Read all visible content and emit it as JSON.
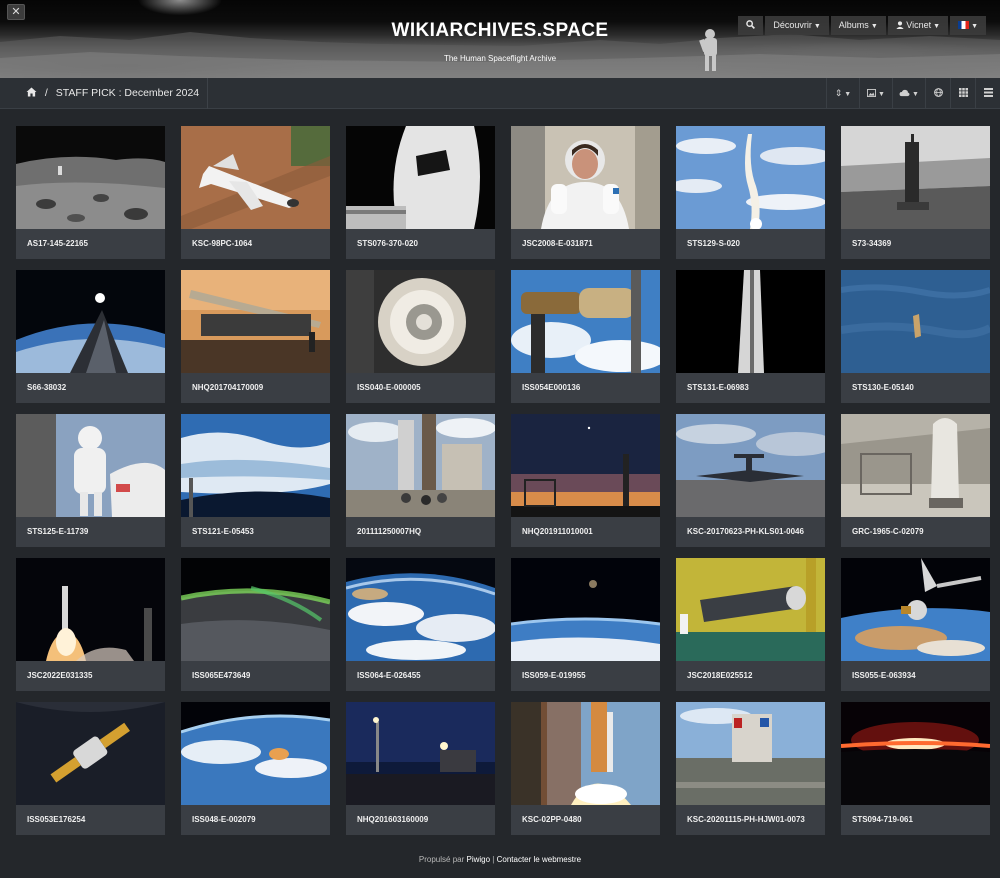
{
  "header": {
    "site_title": "WIKIARCHIVES.SPACE",
    "subtitle": "The Human Spaceflight Archive",
    "admin_icon": "tools-icon",
    "nav": [
      {
        "label": "Découvrir",
        "icon": "caret-down-icon"
      },
      {
        "label": "Albums",
        "icon": "caret-down-icon"
      },
      {
        "label": "Vicnet",
        "icon": "user-icon"
      }
    ],
    "search_icon": "search-icon",
    "language_flag": "flag-france-icon"
  },
  "breadcrumb": {
    "home_icon": "home-icon",
    "separator": "/",
    "current": "STAFF PICK : December 2024"
  },
  "toolbar": {
    "icons": [
      "sort-icon",
      "image-size-icon",
      "download-icon",
      "globe-icon",
      "grid-view-icon",
      "list-view-icon"
    ]
  },
  "photos": [
    {
      "title": "AS17-145-22165"
    },
    {
      "title": "KSC-98PC-1064"
    },
    {
      "title": "STS076-370-020"
    },
    {
      "title": "JSC2008-E-031871"
    },
    {
      "title": "STS129-S-020"
    },
    {
      "title": "S73-34369"
    },
    {
      "title": "S66-38032"
    },
    {
      "title": "NHQ201704170009"
    },
    {
      "title": "ISS040-E-000005"
    },
    {
      "title": "ISS054E000136"
    },
    {
      "title": "STS131-E-06983"
    },
    {
      "title": "STS130-E-05140"
    },
    {
      "title": "STS125-E-11739"
    },
    {
      "title": "STS121-E-05453"
    },
    {
      "title": "201111250007HQ"
    },
    {
      "title": "NHQ201911010001"
    },
    {
      "title": "KSC-20170623-PH-KLS01-0046"
    },
    {
      "title": "GRC-1965-C-02079"
    },
    {
      "title": "JSC2022E031335"
    },
    {
      "title": "ISS065E473649"
    },
    {
      "title": "ISS064-E-026455"
    },
    {
      "title": "ISS059-E-019955"
    },
    {
      "title": "JSC2018E025512"
    },
    {
      "title": "ISS055-E-063934"
    },
    {
      "title": "ISS053E176254"
    },
    {
      "title": "ISS048-E-002079"
    },
    {
      "title": "NHQ201603160009"
    },
    {
      "title": "KSC-02PP-0480"
    },
    {
      "title": "KSC-20201115-PH-HJW01-0073"
    },
    {
      "title": "STS094-719-061"
    }
  ],
  "footer": {
    "powered_by": "Propulsé par",
    "piwigo": "Piwigo",
    "separator": "|",
    "contact": "Contacter le webmestre"
  }
}
